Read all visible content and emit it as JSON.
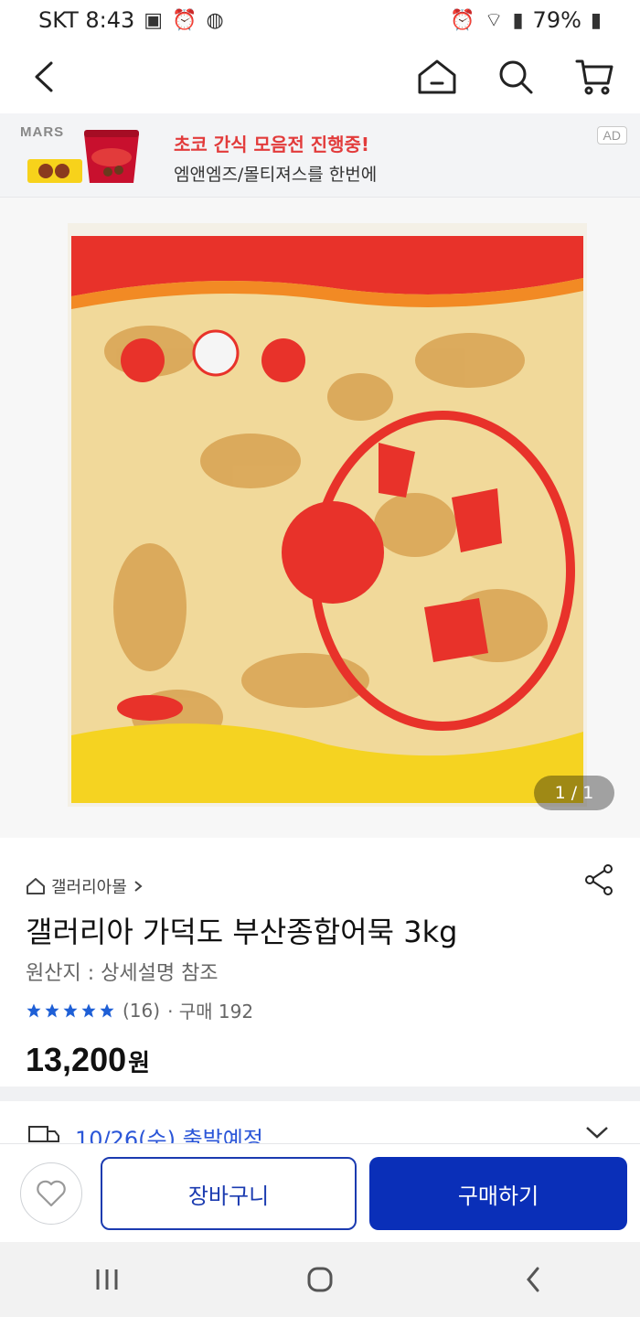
{
  "status": {
    "carrier_time": "SKT 8:43",
    "battery": "79%"
  },
  "nav": {
    "back_icon": "back-arrow-icon",
    "home_icon": "home-icon",
    "search_icon": "search-icon",
    "cart_icon": "cart-icon"
  },
  "ad": {
    "brand": "MARS",
    "title": "초코 간식 모음전 진행중!",
    "subtitle": "엠앤엠즈/몰티져스를 한번에",
    "badge": "AD",
    "colors": {
      "title": "#e23b3b"
    }
  },
  "gallery": {
    "counter": "1 / 1"
  },
  "product": {
    "store": "갤러리아몰",
    "title": "갤러리아 가덕도 부산종합어묵 3kg",
    "origin": "원산지 : 상세설명 참조",
    "rating_count": "(16)",
    "purchases": "· 구매 192",
    "rating_stars": 5,
    "price": "13,200",
    "price_unit": "원"
  },
  "delivery": {
    "text": "10/26(수) 출발예정"
  },
  "actions": {
    "cart_label": "장바구니",
    "buy_label": "구매하기",
    "accent": "#0a2fb8"
  }
}
